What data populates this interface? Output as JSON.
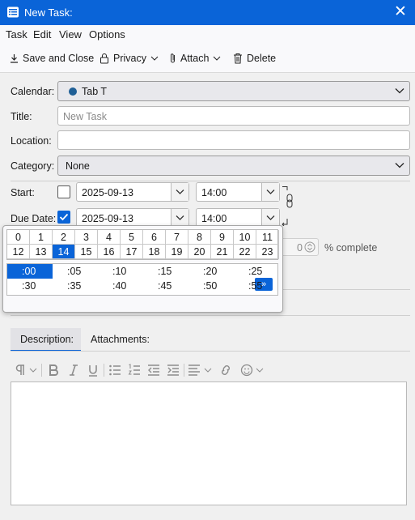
{
  "window": {
    "title": "New Task:"
  },
  "menu": {
    "items": [
      "Task",
      "Edit",
      "View",
      "Options"
    ]
  },
  "toolbar": {
    "save_close": "Save and Close",
    "privacy": "Privacy",
    "attach": "Attach",
    "delete": "Delete"
  },
  "form": {
    "calendar_label": "Calendar:",
    "calendar_value": "Tab T",
    "calendar_color": "#1f5f96",
    "title_label": "Title:",
    "title_placeholder": "New Task",
    "location_label": "Location:",
    "location_value": "",
    "category_label": "Category:",
    "category_value": "None",
    "start_label": "Start:",
    "start_checked": false,
    "start_date": "2025-09-13",
    "start_time": "14:00",
    "due_label": "Due Date:",
    "due_checked": true,
    "due_date": "2025-09-13",
    "due_time": "14:00",
    "percent_value": "0",
    "percent_label": "% complete"
  },
  "time_picker": {
    "hours_row1": [
      "0",
      "1",
      "2",
      "3",
      "4",
      "5",
      "6",
      "7",
      "8",
      "9",
      "10",
      "11"
    ],
    "hours_row2": [
      "12",
      "13",
      "14",
      "15",
      "16",
      "17",
      "18",
      "19",
      "20",
      "21",
      "22",
      "23"
    ],
    "selected_hour": "14",
    "minutes_row1": [
      ":00",
      ":05",
      ":10",
      ":15",
      ":20",
      ":25"
    ],
    "minutes_row2": [
      ":30",
      ":35",
      ":40",
      ":45",
      ":50",
      ":55"
    ],
    "selected_minute": ":00",
    "more_label": "»"
  },
  "tabs": {
    "description": "Description:",
    "attachments": "Attachments:"
  },
  "colors": {
    "accent": "#0a64d8"
  }
}
